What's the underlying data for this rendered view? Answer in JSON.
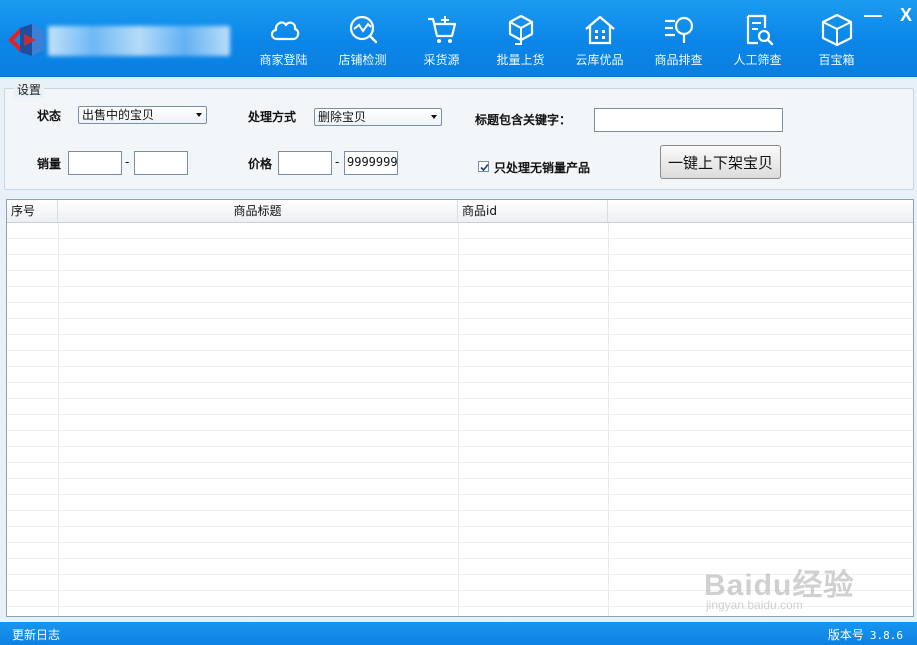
{
  "header": {
    "nav": [
      {
        "label": "商家登陆",
        "icon": "cloud-icon"
      },
      {
        "label": "店铺检测",
        "icon": "store-check-icon"
      },
      {
        "label": "采货源",
        "icon": "cart-plus-icon"
      },
      {
        "label": "批量上货",
        "icon": "box-upload-icon"
      },
      {
        "label": "云库优品",
        "icon": "warehouse-icon"
      },
      {
        "label": "商品排查",
        "icon": "list-search-icon"
      },
      {
        "label": "人工筛查",
        "icon": "document-search-icon"
      },
      {
        "label": "百宝箱",
        "icon": "cube-icon"
      }
    ],
    "minimize": "—",
    "close": "X"
  },
  "settings": {
    "legend": "设置",
    "status_label": "状态",
    "status_value": "出售中的宝贝",
    "method_label": "处理方式",
    "method_value": "删除宝贝",
    "keyword_label": "标题包含关键字：",
    "keyword_value": "",
    "sales_label": "销量",
    "sales_min": "",
    "sales_max": "",
    "price_label": "价格",
    "price_min": "",
    "price_max": "9999999",
    "range_sep": "-",
    "only_zero_sales_label": "只处理无销量产品",
    "only_zero_sales_checked": true,
    "action_button": "一键上下架宝贝"
  },
  "table": {
    "columns": [
      "序号",
      "商品标题",
      "商品id",
      ""
    ],
    "rows": []
  },
  "statusbar": {
    "changelog": "更新日志",
    "version_label": "版本号",
    "version": "3.8.6"
  },
  "watermark": {
    "brand": "Baidu经验",
    "url": "jingyan.baidu.com"
  },
  "colors": {
    "header_blue": "#0b86e8",
    "status_blue": "#0c82e3",
    "logo_red": "#e02424"
  }
}
